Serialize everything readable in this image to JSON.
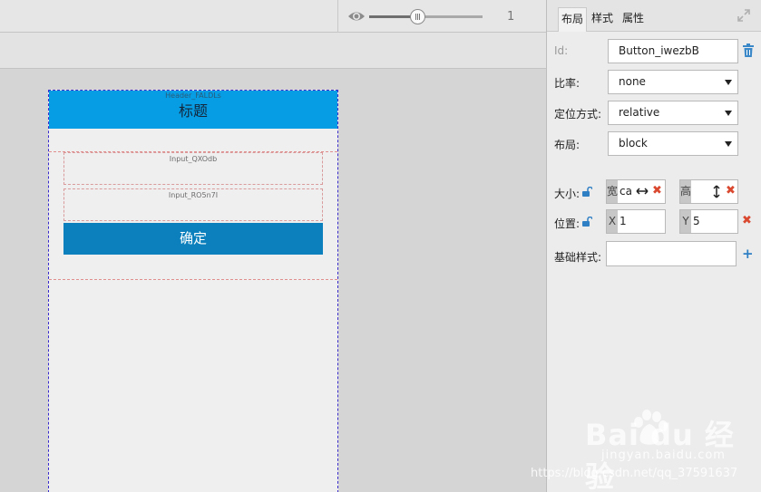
{
  "toolbar": {
    "zoom_value": "1",
    "zoom_fraction": 0.42
  },
  "canvas": {
    "header_tag": "Header_FALDLs",
    "header_title": "标题",
    "input1_tag": "Input_QXOdb",
    "input2_tag": "Input_RO5n7I",
    "confirm_label": "确定"
  },
  "panel": {
    "tabs": [
      "布局",
      "样式",
      "属性"
    ],
    "active_tab": "布局",
    "id_label": "Id:",
    "id_value": "Button_iwezbB",
    "ratio_label": "比率:",
    "ratio_value": "none",
    "position_label": "定位方式:",
    "position_value": "relative",
    "layout_label": "布局:",
    "layout_value": "block",
    "size_label": "大小:",
    "width_tag": "宽",
    "width_value": "ca",
    "height_tag": "高",
    "height_value": "",
    "place_label": "位置:",
    "x_tag": "X",
    "x_value": "1",
    "y_tag": "Y",
    "y_value": "5",
    "base_style_label": "基础样式:",
    "base_style_value": ""
  },
  "watermark": {
    "logo": "Bai du 经验",
    "sub": "jingyan.baidu.com",
    "url": "https://blog.csdn.net/qq_37591637"
  },
  "colors": {
    "header_blue": "#069de5",
    "button_blue": "#0b80bd",
    "danger_red": "#d9482f",
    "link_blue": "#2f7fc4"
  }
}
